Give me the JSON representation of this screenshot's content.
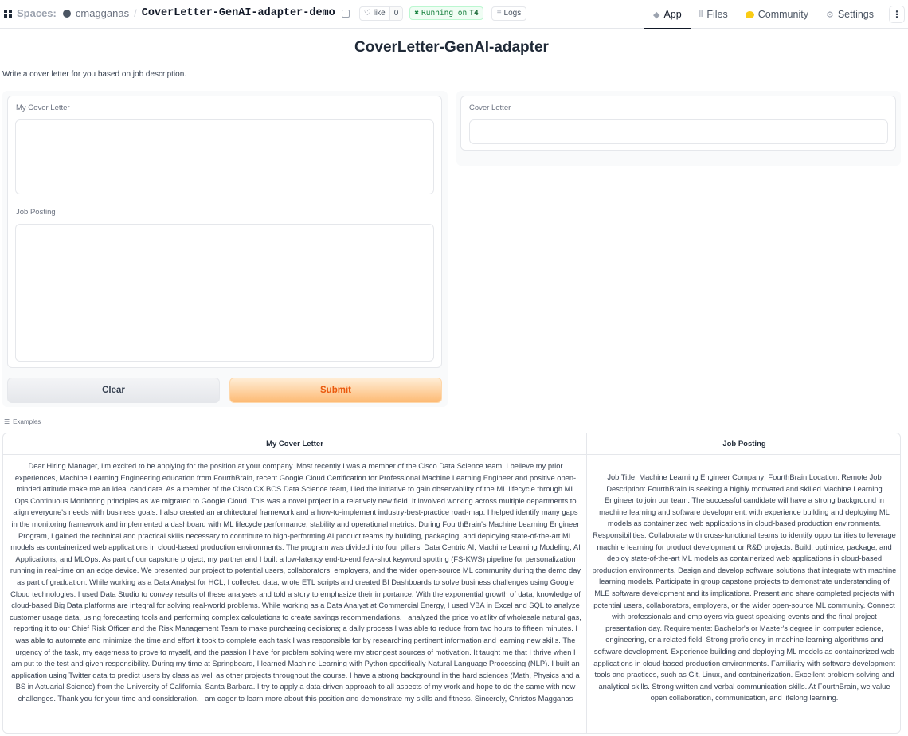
{
  "topbar": {
    "spaces_label": "Spaces:",
    "owner": "cmagganas",
    "separator": "/",
    "repo_name": "CoverLetter-GenAI-adapter-demo",
    "like_label": "like",
    "like_count": "0",
    "status_prefix": "Running on",
    "status_hardware": "T4",
    "logs_label": "Logs",
    "tabs": [
      {
        "label": "App",
        "icon": "cube-icon",
        "active": true
      },
      {
        "label": "Files",
        "icon": "files-icon",
        "active": false
      },
      {
        "label": "Community",
        "icon": "community-icon",
        "active": false
      },
      {
        "label": "Settings",
        "icon": "gear-icon",
        "active": false
      }
    ],
    "more_icon": "kebab-menu-icon"
  },
  "app": {
    "title": "CoverLetter-GenAI-adapter",
    "description": "Write a cover letter for you based on job description."
  },
  "inputs": {
    "cover_letter_label": "My Cover Letter",
    "cover_letter_value": "",
    "job_posting_label": "Job Posting",
    "job_posting_value": "",
    "clear_label": "Clear",
    "submit_label": "Submit"
  },
  "output": {
    "label": "Cover Letter",
    "value": ""
  },
  "examples": {
    "label": "Examples",
    "headers": [
      "My Cover Letter",
      "Job Posting"
    ],
    "rows": [
      {
        "cover_letter": "Dear Hiring Manager, I'm excited to be applying for the position at your company. Most recently I was a member of the Cisco Data Science team. I believe my prior experiences, Machine Learning Engineering education from FourthBrain, recent Google Cloud Certification for Professional Machine Learning Engineer and positive open-minded attitude make me an ideal candidate. As a member of the Cisco CX BCS Data Science team, I led the initiative to gain observability of the ML lifecycle through ML Ops Continuous Monitoring principles as we migrated to Google Cloud. This was a novel project in a relatively new field. It involved working across multiple departments to align everyone's needs with business goals. I also created an architectural framework and a how-to-implement industry-best-practice road-map. I helped identify many gaps in the monitoring framework and implemented a dashboard with ML lifecycle performance, stability and operational metrics. During FourthBrain's Machine Learning Engineer Program, I gained the technical and practical skills necessary to contribute to high-performing AI product teams by building, packaging, and deploying state-of-the-art ML models as containerized web applications in cloud-based production environments. The program was divided into four pillars: Data Centric AI, Machine Learning Modeling, AI Applications, and MLOps. As part of our capstone project, my partner and I built a low-latency end-to-end few-shot keyword spotting (FS-KWS) pipeline for personalization running in real-time on an edge device. We presented our project to potential users, collaborators, employers, and the wider open-source ML community during the demo day as part of graduation. While working as a Data Analyst for HCL, I collected data, wrote ETL scripts and created BI Dashboards to solve business challenges using Google Cloud technologies. I used Data Studio to convey results of these analyses and told a story to emphasize their importance. With the exponential growth of data, knowledge of cloud-based Big Data platforms are integral for solving real-world problems. While working as a Data Analyst at Commercial Energy, I used VBA in Excel and SQL to analyze customer usage data, using forecasting tools and performing complex calculations to create savings recommendations. I analyzed the price volatility of wholesale natural gas, reporting it to our Chief Risk Officer and the Risk Management Team to make purchasing decisions; a daily process I was able to reduce from two hours to fifteen minutes. I was able to automate and minimize the time and effort it took to complete each task I was responsible for by researching pertinent information and learning new skills. The urgency of the task, my eagerness to prove to myself, and the passion I have for problem solving were my strongest sources of motivation. It taught me that I thrive when I am put to the test and given responsibility. During my time at Springboard, I learned Machine Learning with Python specifically Natural Language Processing (NLP). I built an application using Twitter data to predict users by class as well as other projects throughout the course. I have a strong background in the hard sciences (Math, Physics and a BS in Actuarial Science) from the University of California, Santa Barbara. I try to apply a data-driven approach to all aspects of my work and hope to do the same with new challenges. Thank you for your time and consideration. I am eager to learn more about this position and demonstrate my skills and fitness. Sincerely, Christos Magganas",
        "job_posting": "Job Title: Machine Learning Engineer Company: FourthBrain Location: Remote Job Description: FourthBrain is seeking a highly motivated and skilled Machine Learning Engineer to join our team. The successful candidate will have a strong background in machine learning and software development, with experience building and deploying ML models as containerized web applications in cloud-based production environments. Responsibilities: Collaborate with cross-functional teams to identify opportunities to leverage machine learning for product development or R&D projects. Build, optimize, package, and deploy state-of-the-art ML models as containerized web applications in cloud-based production environments. Design and develop software solutions that integrate with machine learning models. Participate in group capstone projects to demonstrate understanding of MLE software development and its implications. Present and share completed projects with potential users, collaborators, employers, or the wider open-source ML community. Connect with professionals and employers via guest speaking events and the final project presentation day. Requirements: Bachelor's or Master's degree in computer science, engineering, or a related field. Strong proficiency in machine learning algorithms and software development. Experience building and deploying ML models as containerized web applications in cloud-based production environments. Familiarity with software development tools and practices, such as Git, Linux, and containerization. Excellent problem-solving and analytical skills. Strong written and verbal communication skills. At FourthBrain, we value open collaboration, communication, and lifelong learning."
      }
    ]
  }
}
